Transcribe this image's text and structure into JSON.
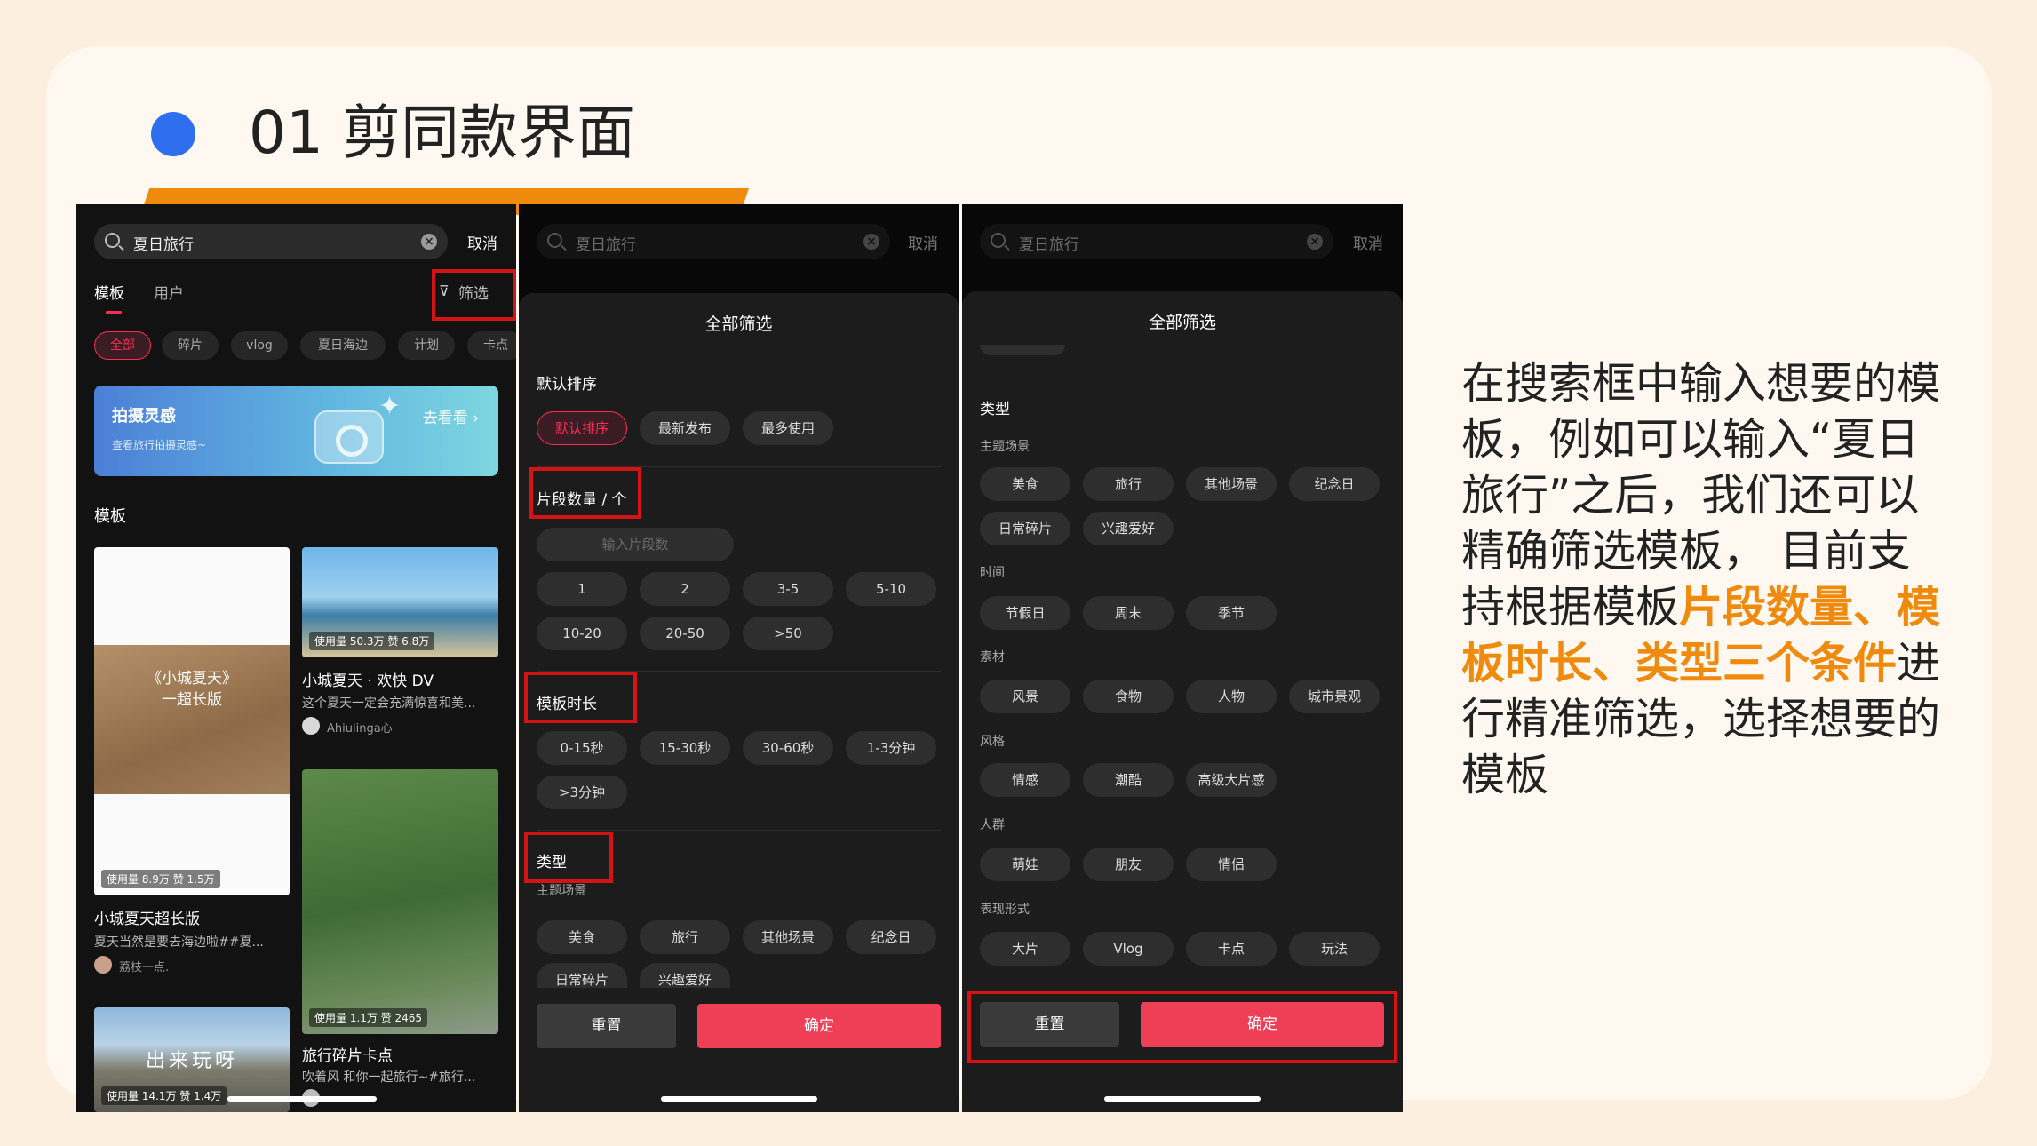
{
  "slide": {
    "title": "01 剪同款界面",
    "description": {
      "before": "在搜索框中输入想要的模板，例如可以输入“夏日旅行”之后，我们还可以精确筛选模板， 目前支持根据模板",
      "highlight": "片段数量、模板时长、类型三个条件",
      "after": "进行精准筛选，选择想要的模板"
    },
    "colors": {
      "accent": "#f08a0c",
      "dot": "#2e6ff0",
      "brand_red": "#fe2c55",
      "annotation_box": "#d41414"
    }
  },
  "search": {
    "query": "夏日旅行",
    "cancel": "取消"
  },
  "tabs": {
    "templates": "模板",
    "users": "用户",
    "filter": "筛选"
  },
  "chips": [
    "全部",
    "碎片",
    "vlog",
    "夏日海边",
    "计划",
    "卡点"
  ],
  "banner": {
    "title": "拍摄灵感",
    "subtitle": "查看旅行拍摄灵感~",
    "link": "去看看 ›"
  },
  "section_title": "模板",
  "templates": [
    {
      "overlay_text": "《小城夏天》\n一超长版",
      "stats": "使用量 8.9万 赞 1.5万",
      "title": "小城夏天超长版",
      "desc": "夏天当然是要去海边啦##夏...",
      "author": "荔枝一点."
    },
    {
      "overlay_text": "",
      "stats": "使用量 50.3万 赞 6.8万",
      "title": "小城夏天 · 欢快 DV",
      "desc": "这个夏天一定会充满惊喜和美...",
      "author": "Ahiulinga心"
    },
    {
      "overlay_text": "",
      "stats": "使用量 1.1万 赞 2465",
      "title": "旅行碎片卡点",
      "desc": "吹着风 和你一起旅行~#旅行...",
      "author": ""
    },
    {
      "overlay_text": "出来玩呀",
      "stats": "使用量 14.1万 赞 1.4万",
      "title": "",
      "desc": "",
      "author": ""
    }
  ],
  "filter_sheet": {
    "title": "全部筛选",
    "sort": {
      "label": "默认排序",
      "options": [
        "默认排序",
        "最新发布",
        "最多使用"
      ],
      "selected": "默认排序"
    },
    "count": {
      "label": "片段数量 / 个",
      "placeholder": "输入片段数",
      "options": [
        "1",
        "2",
        "3-5",
        "5-10",
        "10-20",
        "20-50",
        ">50"
      ]
    },
    "duration": {
      "label": "模板时长",
      "options": [
        "0-15秒",
        "15-30秒",
        "30-60秒",
        "1-3分钟",
        ">3分钟"
      ]
    },
    "type": {
      "label": "类型",
      "groups": [
        {
          "name": "主题场景",
          "options": [
            "美食",
            "旅行",
            "其他场景",
            "纪念日",
            "日常碎片",
            "兴趣爱好"
          ]
        },
        {
          "name": "时间",
          "options": [
            "节假日",
            "周末",
            "季节"
          ]
        },
        {
          "name": "素材",
          "options": [
            "风景",
            "食物",
            "人物",
            "城市景观"
          ]
        },
        {
          "name": "风格",
          "options": [
            "情感",
            "潮酷",
            "高级大片感"
          ]
        },
        {
          "name": "人群",
          "options": [
            "萌娃",
            "朋友",
            "情侣"
          ]
        },
        {
          "name": "表现形式",
          "options": [
            "大片",
            "Vlog",
            "卡点",
            "玩法"
          ]
        }
      ]
    },
    "reset": "重置",
    "confirm": "确定"
  }
}
